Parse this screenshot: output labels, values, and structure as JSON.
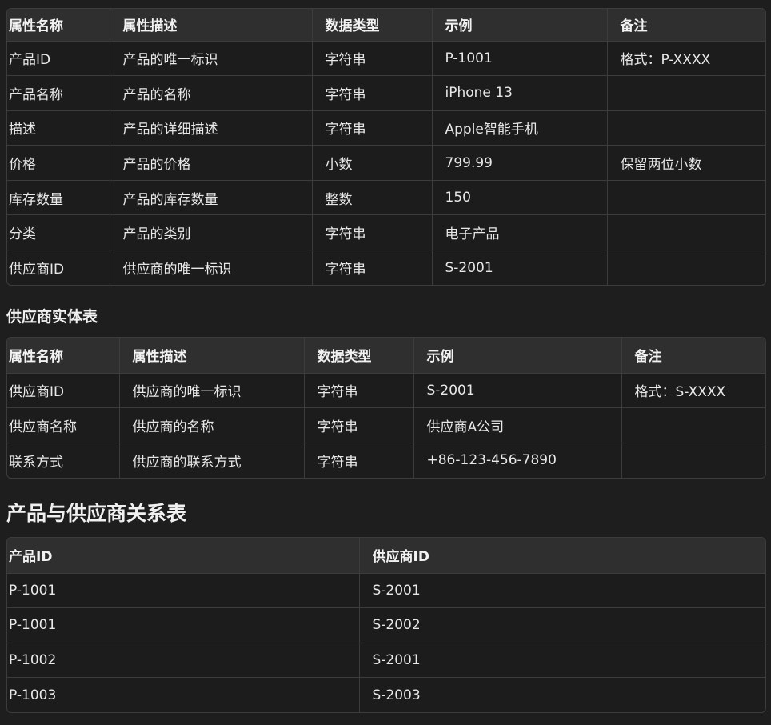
{
  "product_table": {
    "headers": [
      "属性名称",
      "属性描述",
      "数据类型",
      "示例",
      "备注"
    ],
    "rows": [
      [
        "产品ID",
        "产品的唯一标识",
        "字符串",
        "P-1001",
        "格式：P-XXXX"
      ],
      [
        "产品名称",
        "产品的名称",
        "字符串",
        "iPhone 13",
        ""
      ],
      [
        "描述",
        "产品的详细描述",
        "字符串",
        "Apple智能手机",
        ""
      ],
      [
        "价格",
        "产品的价格",
        "小数",
        "799.99",
        "保留两位小数"
      ],
      [
        "库存数量",
        "产品的库存数量",
        "整数",
        "150",
        ""
      ],
      [
        "分类",
        "产品的类别",
        "字符串",
        "电子产品",
        ""
      ],
      [
        "供应商ID",
        "供应商的唯一标识",
        "字符串",
        "S-2001",
        ""
      ]
    ]
  },
  "supplier_section_title": "供应商实体表",
  "supplier_table": {
    "headers": [
      "属性名称",
      "属性描述",
      "数据类型",
      "示例",
      "备注"
    ],
    "rows": [
      [
        "供应商ID",
        "供应商的唯一标识",
        "字符串",
        "S-2001",
        "格式：S-XXXX"
      ],
      [
        "供应商名称",
        "供应商的名称",
        "字符串",
        "供应商A公司",
        ""
      ],
      [
        "联系方式",
        "供应商的联系方式",
        "字符串",
        "+86-123-456-7890",
        ""
      ]
    ]
  },
  "relation_section_title": "产品与供应商关系表",
  "relation_table": {
    "headers": [
      "产品ID",
      "供应商ID"
    ],
    "rows": [
      [
        "P-1001",
        "S-2001"
      ],
      [
        "P-1001",
        "S-2002"
      ],
      [
        "P-1002",
        "S-2001"
      ],
      [
        "P-1003",
        "S-2003"
      ]
    ]
  }
}
